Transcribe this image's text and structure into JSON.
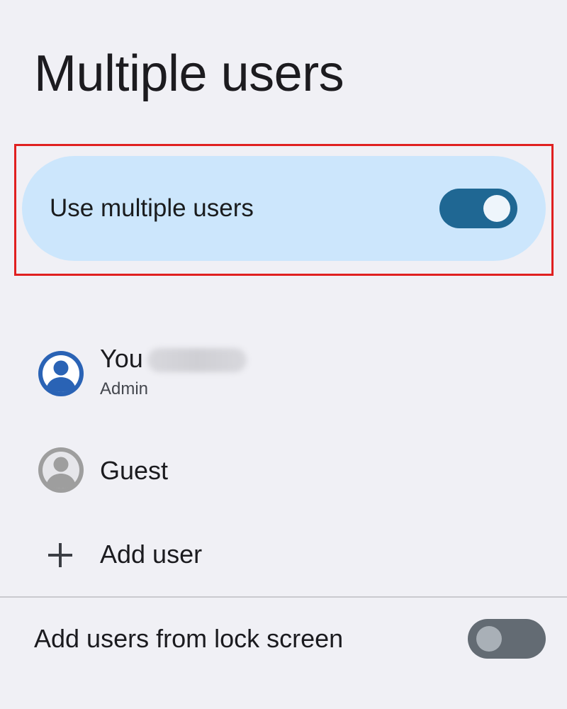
{
  "page": {
    "title": "Multiple users"
  },
  "main_switch": {
    "label": "Use multiple users",
    "state": "on",
    "on_color": "#1f6793"
  },
  "users": [
    {
      "name": "You",
      "subtitle": "Admin",
      "name_suffix_blurred": true,
      "icon": "account-circle-icon",
      "icon_color": "#2a63b5"
    },
    {
      "name": "Guest",
      "icon": "account-circle-icon",
      "icon_color": "#9e9e9e"
    }
  ],
  "add_user": {
    "label": "Add user",
    "icon": "plus-icon"
  },
  "lock_screen_switch": {
    "label": "Add users from lock screen",
    "state": "off"
  },
  "colors": {
    "background": "#f0f0f5",
    "card": "#cce6fc",
    "highlight_border": "#e02020"
  }
}
